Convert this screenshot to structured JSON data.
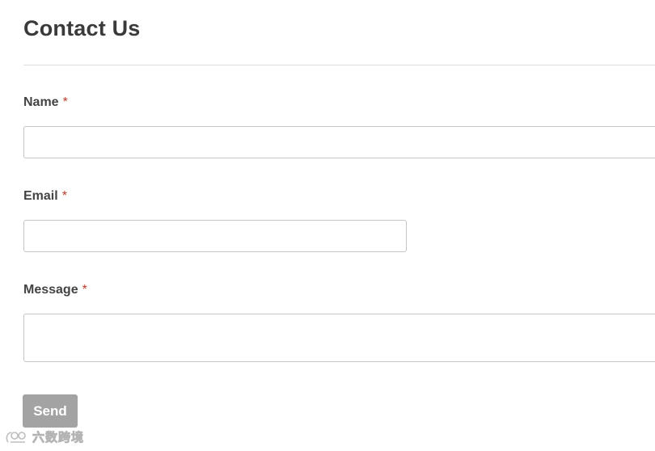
{
  "page": {
    "title": "Contact Us"
  },
  "form": {
    "required_marker": "*",
    "name": {
      "label": "Name",
      "value": ""
    },
    "email": {
      "label": "Email",
      "value": ""
    },
    "message": {
      "label": "Message",
      "value": ""
    },
    "send_label": "Send"
  },
  "watermark": {
    "text": "六数跨境",
    "icon": "logo-icon"
  },
  "colors": {
    "required": "#c0392b",
    "button": "#a3a3a3"
  }
}
